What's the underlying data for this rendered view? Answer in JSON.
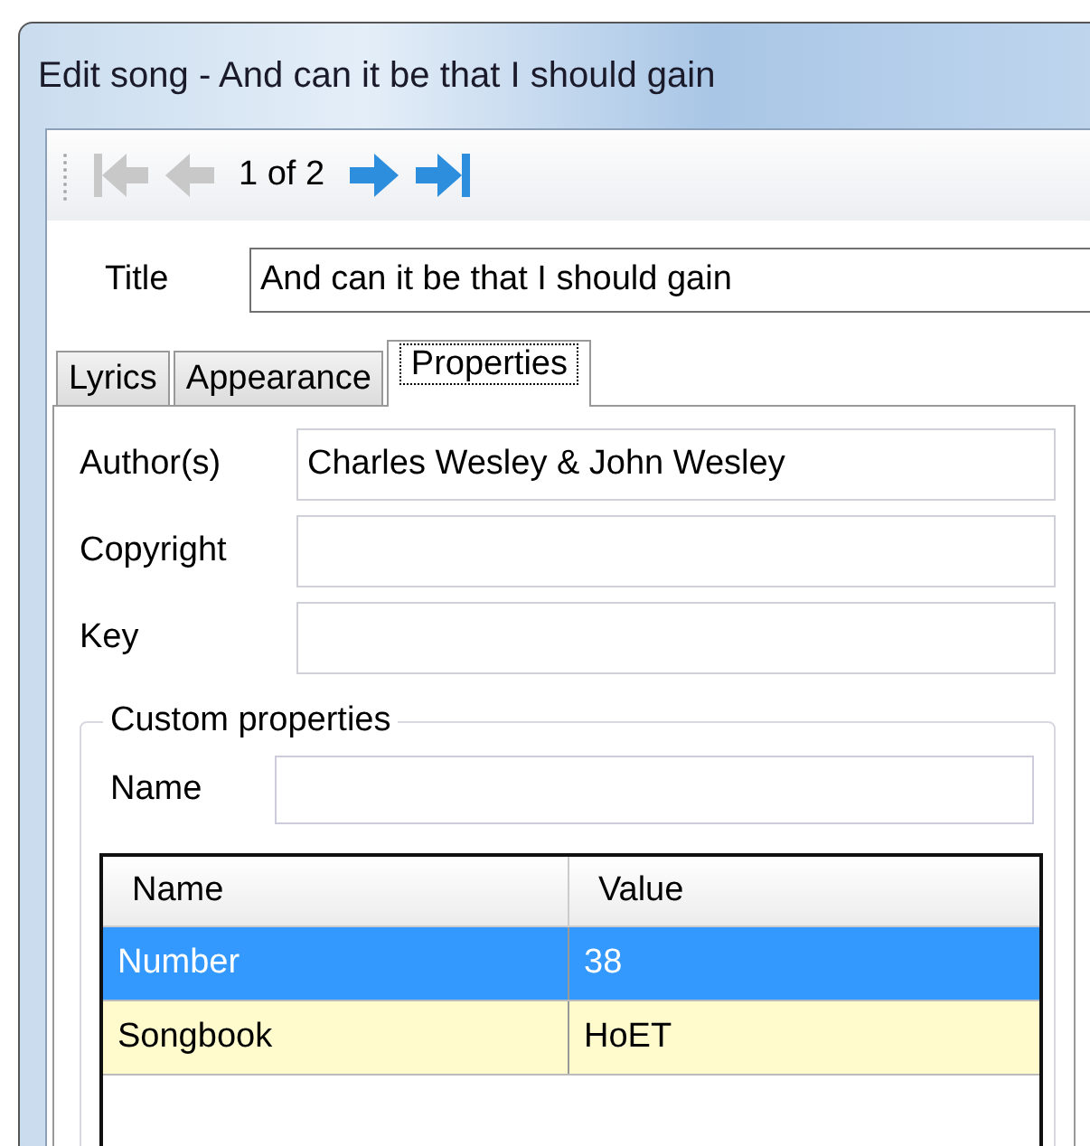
{
  "window": {
    "title": "Edit song - And can it be that I should gain"
  },
  "navigator": {
    "position": "1 of 2",
    "buttons": [
      {
        "kind": "first",
        "disabled": true
      },
      {
        "kind": "previous",
        "disabled": true
      },
      {
        "kind": "next",
        "disabled": false
      },
      {
        "kind": "last",
        "disabled": false
      }
    ]
  },
  "title_field": {
    "label": "Title",
    "value": "And can it be that I should gain"
  },
  "tabs": [
    {
      "label": "Lyrics",
      "selected": false
    },
    {
      "label": "Appearance",
      "selected": false
    },
    {
      "label": "Properties",
      "selected": true
    }
  ],
  "fields": [
    {
      "label": "Author(s)",
      "value": "Charles Wesley & John Wesley"
    },
    {
      "label": "Copyright"
    },
    {
      "label": "Key"
    }
  ],
  "custom_properties": {
    "title": "Custom properties",
    "name_label": "Name",
    "table": {
      "columns": [
        "Name",
        "Value"
      ],
      "rows": [
        {
          "cells": [
            "Number",
            "38"
          ],
          "selected": true,
          "highlighted": false
        },
        {
          "cells": [
            "Songbook",
            "HoET"
          ],
          "selected": false,
          "highlighted": true
        }
      ]
    }
  }
}
